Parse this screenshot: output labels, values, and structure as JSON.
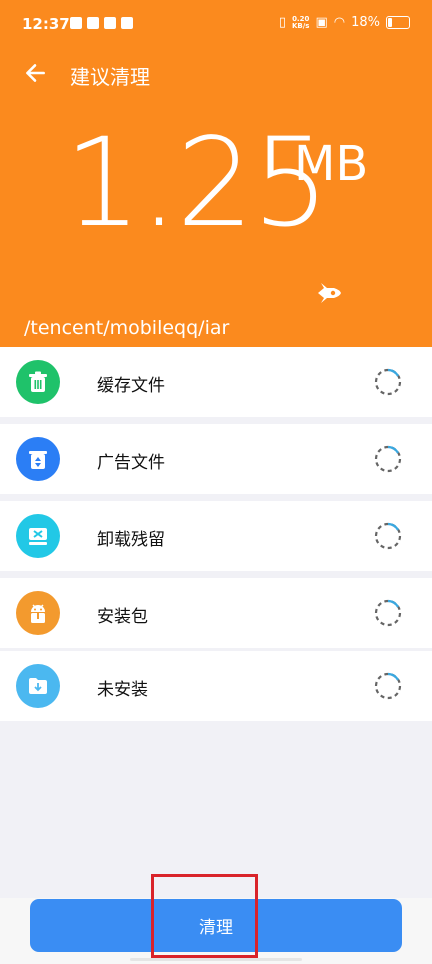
{
  "status_bar": {
    "time": "12:37",
    "net_speed_top": "0.20",
    "net_speed_bottom": "KB/s",
    "battery": "18%"
  },
  "header": {
    "title": "建议清理",
    "size_value": "1.25",
    "size_unit": "MB",
    "path": "/tencent/mobileqq/iar"
  },
  "items": [
    {
      "label": "缓存文件",
      "icon": "trash-icon",
      "color": "#1fc26a"
    },
    {
      "label": "广告文件",
      "icon": "recycle-bin-icon",
      "color": "#2b7ef5"
    },
    {
      "label": "卸载残留",
      "icon": "uninstall-residue-icon",
      "color": "#22c8e6"
    },
    {
      "label": "安装包",
      "icon": "android-package-icon",
      "color": "#f39a2e"
    },
    {
      "label": "未安装",
      "icon": "folder-download-icon",
      "color": "#4bb8f0"
    }
  ],
  "button": {
    "label": "清理"
  },
  "colors": {
    "accent": "#fb8a1e",
    "button": "#3a8df3",
    "highlight": "#d9232a"
  }
}
